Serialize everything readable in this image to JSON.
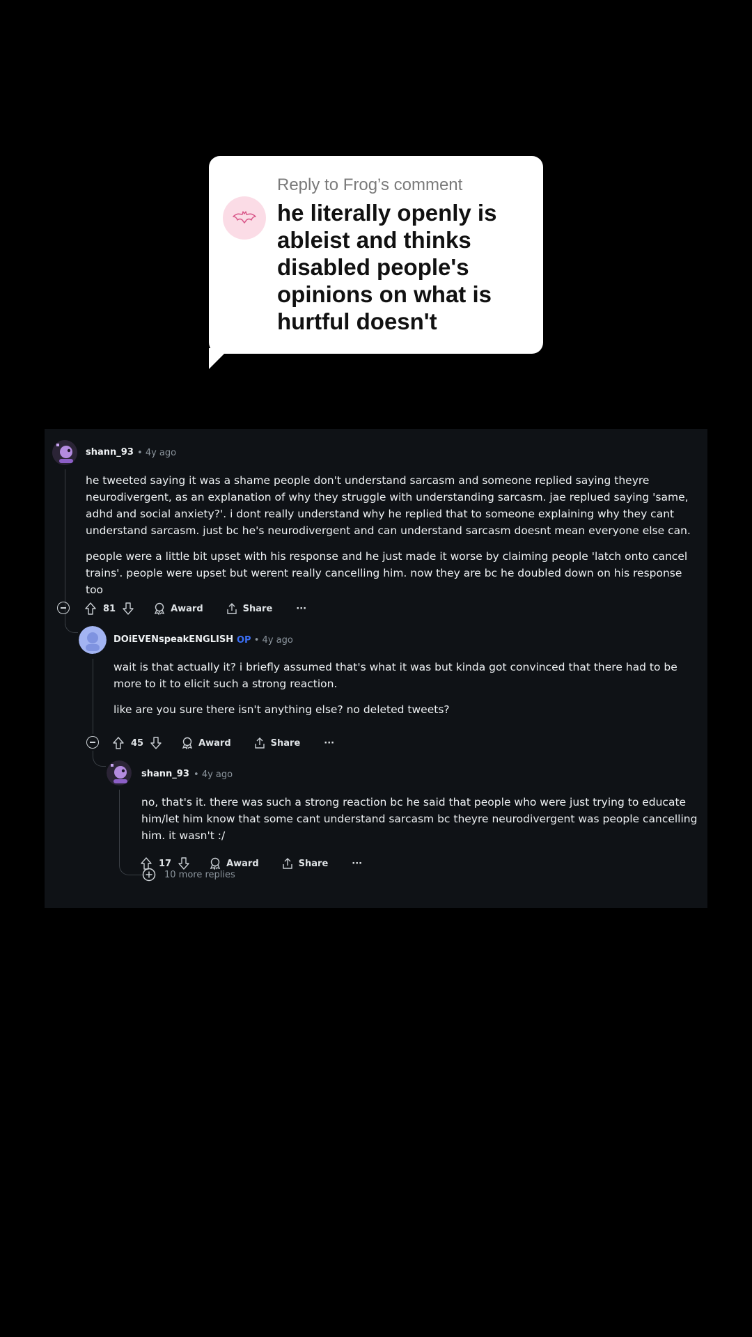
{
  "reply_bubble": {
    "header": "Reply to Frog’s comment",
    "text": "he literally openly is ableist and thinks disabled people's opinions on what is hurtful doesn't"
  },
  "comments": [
    {
      "username": "shann_93",
      "time": "4y ago",
      "paragraphs": [
        "he tweeted saying it was a shame people don't understand sarcasm and someone replied saying theyre neurodivergent, as an explanation of why they struggle with understanding sarcasm. jae replued saying 'same, adhd and social anxiety?'. i dont really understand why he replied that to someone explaining why they cant understand sarcasm. just bc he's neurodivergent and can understand sarcasm doesnt mean everyone else can.",
        "people were a little bit upset with his response and he just made it worse by claiming people 'latch onto cancel trains'. people were upset but werent really cancelling him. now they are bc he doubled down on his response too"
      ],
      "votes": "81",
      "award_label": "Award",
      "share_label": "Share",
      "more_label": "···"
    },
    {
      "username": "DOiEVENspeakENGLISH",
      "op_badge": "OP",
      "time": "4y ago",
      "paragraphs": [
        "wait is that actually it? i briefly assumed that's what it was but kinda got convinced that there had to be more to it to elicit such a strong reaction.",
        "like are you sure there isn't anything else? no deleted tweets?"
      ],
      "votes": "45",
      "award_label": "Award",
      "share_label": "Share",
      "more_label": "···"
    },
    {
      "username": "shann_93",
      "time": "4y ago",
      "paragraphs": [
        "no, that's it. there was such a strong reaction bc he said that people who were just trying to educate him/let him know that some cant understand sarcasm bc theyre neurodivergent was people cancelling him. it wasn't :/"
      ],
      "votes": "17",
      "award_label": "Award",
      "share_label": "Share",
      "more_label": "···"
    }
  ],
  "more_replies": "10 more replies",
  "separator": "•",
  "colors": {
    "op_badge": "#3b6ff5",
    "panel_bg": "#0f1216",
    "bubble_avatar_bg": "#fbdce6"
  }
}
